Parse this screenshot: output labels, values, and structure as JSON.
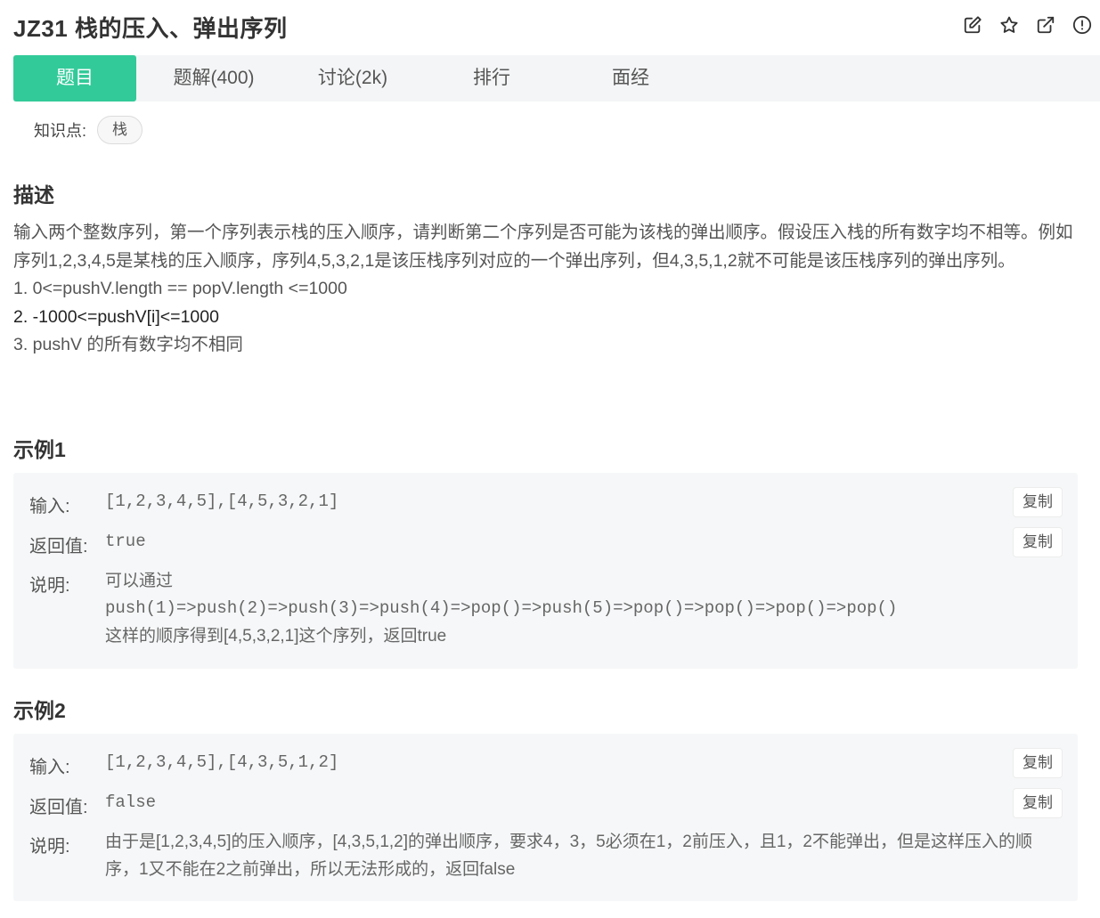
{
  "header": {
    "title": "JZ31  栈的压入、弹出序列",
    "icons": [
      "edit-icon",
      "star-icon",
      "external-link-icon",
      "info-icon"
    ]
  },
  "tabs": [
    {
      "label": "题目",
      "active": true
    },
    {
      "label": "题解(400)",
      "active": false
    },
    {
      "label": "讨论(2k)",
      "active": false
    },
    {
      "label": "排行",
      "active": false
    },
    {
      "label": "面经",
      "active": false
    }
  ],
  "knowledge": {
    "label": "知识点:",
    "tag": "栈"
  },
  "description": {
    "title": "描述",
    "paragraph": "输入两个整数序列，第一个序列表示栈的压入顺序，请判断第二个序列是否可能为该栈的弹出顺序。假设压入栈的所有数字均不相等。例如序列1,2,3,4,5是某栈的压入顺序，序列4,5,3,2,1是该压栈序列对应的一个弹出序列，但4,3,5,1,2就不可能是该压栈序列的弹出序列。",
    "items": [
      "1. 0<=pushV.length == popV.length <=1000",
      "2. -1000<=pushV[i]<=1000",
      "3. pushV 的所有数字均不相同"
    ]
  },
  "examples": [
    {
      "title": "示例1",
      "input_label": "输入:",
      "input": "[1,2,3,4,5],[4,5,3,2,1]",
      "output_label": "返回值:",
      "output": "true",
      "explain_label": "说明:",
      "explain_lines": [
        "可以通过",
        "push(1)=>push(2)=>push(3)=>push(4)=>pop()=>push(5)=>pop()=>pop()=>pop()=>pop()",
        "这样的顺序得到[4,5,3,2,1]这个序列，返回true"
      ],
      "copy_label": "复制"
    },
    {
      "title": "示例2",
      "input_label": "输入:",
      "input": "[1,2,3,4,5],[4,3,5,1,2]",
      "output_label": "返回值:",
      "output": "false",
      "explain_label": "说明:",
      "explain": "由于是[1,2,3,4,5]的压入顺序，[4,3,5,1,2]的弹出顺序，要求4，3，5必须在1，2前压入，且1，2不能弹出，但是这样压入的顺序，1又不能在2之前弹出，所以无法形成的，返回false",
      "copy_label": "复制"
    }
  ],
  "colors": {
    "accent": "#32ca99",
    "tab_bg": "#f4f5f6",
    "example_bg": "#f6f7f8"
  }
}
